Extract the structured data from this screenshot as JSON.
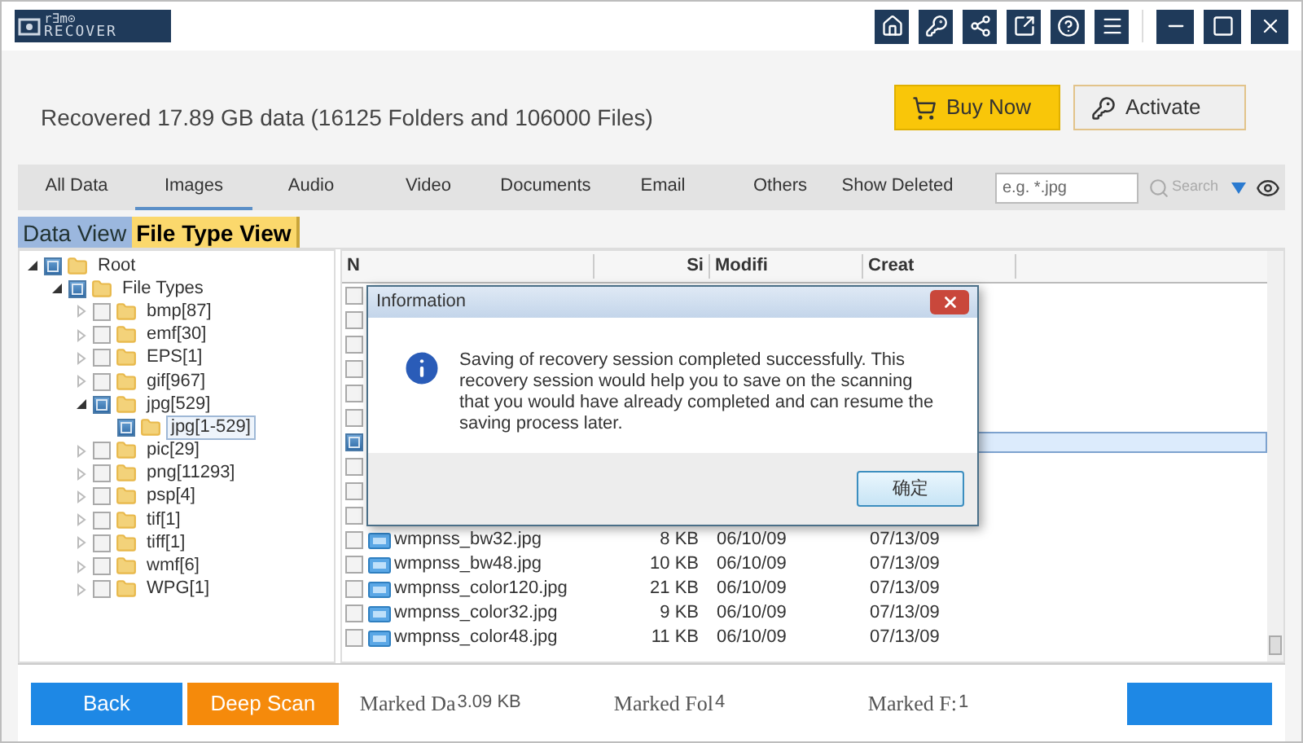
{
  "app": {
    "logo_top": "r∃m⊙",
    "logo_bottom": "RECOVER"
  },
  "summary": "Recovered 17.89 GB data (16125 Folders and 106000 Files)",
  "header_buttons": [
    {
      "kind": "buy",
      "label": "Buy Now"
    },
    {
      "kind": "activate",
      "label": "Activate"
    }
  ],
  "category_tabs": [
    {
      "label": "All Data",
      "selected": false
    },
    {
      "label": "Images",
      "selected": true
    },
    {
      "label": "Audio",
      "selected": false
    },
    {
      "label": "Video",
      "selected": false
    },
    {
      "label": "Documents",
      "selected": false
    },
    {
      "label": "Email",
      "selected": false
    },
    {
      "label": "Others",
      "selected": false
    },
    {
      "label": "Show Deleted",
      "selected": false
    }
  ],
  "search": {
    "placeholder": "e.g. *.jpg",
    "button": "Search"
  },
  "view_tabs": [
    {
      "label": "Data View",
      "selected": false
    },
    {
      "label": "File Type View",
      "selected": true
    }
  ],
  "tree": [
    {
      "label": "Root",
      "checked": true,
      "expanded": true,
      "selected": false,
      "children": [
        {
          "label": "File Types",
          "checked": true,
          "expanded": true,
          "selected": false,
          "children": [
            {
              "label": "bmp[87]",
              "checked": false,
              "expanded": false,
              "selected": false
            },
            {
              "label": "emf[30]",
              "checked": false,
              "expanded": false,
              "selected": false
            },
            {
              "label": "EPS[1]",
              "checked": false,
              "expanded": false,
              "selected": false
            },
            {
              "label": "gif[967]",
              "checked": false,
              "expanded": false,
              "selected": false
            },
            {
              "label": "jpg[529]",
              "checked": true,
              "expanded": true,
              "selected": false,
              "children": [
                {
                  "label": "jpg[1-529]",
                  "checked": true,
                  "selected": true
                }
              ]
            },
            {
              "label": "pic[29]",
              "checked": false,
              "expanded": false,
              "selected": false
            },
            {
              "label": "png[11293]",
              "checked": false,
              "expanded": false,
              "selected": false
            },
            {
              "label": "psp[4]",
              "checked": false,
              "expanded": false,
              "selected": false
            },
            {
              "label": "tif[1]",
              "checked": false,
              "expanded": false,
              "selected": false
            },
            {
              "label": "tiff[1]",
              "checked": false,
              "expanded": false,
              "selected": false
            },
            {
              "label": "wmf[6]",
              "checked": false,
              "expanded": false,
              "selected": false
            },
            {
              "label": "WPG[1]",
              "checked": false,
              "expanded": false,
              "selected": false
            }
          ]
        }
      ]
    }
  ],
  "table": {
    "columns": [
      "N",
      "Si",
      "Modifi",
      "Creat"
    ],
    "rows": [
      {
        "checked": false,
        "selected": false
      },
      {
        "checked": false,
        "selected": false
      },
      {
        "checked": false,
        "selected": false
      },
      {
        "checked": false,
        "selected": false
      },
      {
        "checked": false,
        "selected": false
      },
      {
        "checked": false,
        "selected": false
      },
      {
        "checked": true,
        "selected": true
      },
      {
        "checked": false,
        "selected": false
      },
      {
        "checked": false,
        "selected": false
      },
      {
        "checked": false,
        "selected": false
      },
      {
        "checked": false,
        "selected": false,
        "name": "wmpnss_bw32.jpg",
        "size": "8 KB",
        "modified": "06/10/09",
        "created": "07/13/09"
      },
      {
        "checked": false,
        "selected": false,
        "name": "wmpnss_bw48.jpg",
        "size": "10 KB",
        "modified": "06/10/09",
        "created": "07/13/09"
      },
      {
        "checked": false,
        "selected": false,
        "name": "wmpnss_color120.jpg",
        "size": "21 KB",
        "modified": "06/10/09",
        "created": "07/13/09"
      },
      {
        "checked": false,
        "selected": false,
        "name": "wmpnss_color32.jpg",
        "size": "9 KB",
        "modified": "06/10/09",
        "created": "07/13/09"
      },
      {
        "checked": false,
        "selected": false,
        "name": "wmpnss_color48.jpg",
        "size": "11 KB",
        "modified": "06/10/09",
        "created": "07/13/09"
      }
    ]
  },
  "dialog": {
    "title": "Information",
    "message": "Saving of recovery session completed successfully. This recovery session would help you to save on the scanning that you would have already completed and can resume the saving process later.",
    "ok": "确定"
  },
  "footer": {
    "buttons": [
      {
        "kind": "back",
        "label": "Back"
      },
      {
        "kind": "deep",
        "label": "Deep Scan"
      }
    ],
    "stats": [
      {
        "label": "Marked Da",
        "value": "3.09 KB"
      },
      {
        "label": "Marked Fol",
        "value": "4"
      },
      {
        "label": "Marked F:",
        "value": "1"
      }
    ]
  }
}
